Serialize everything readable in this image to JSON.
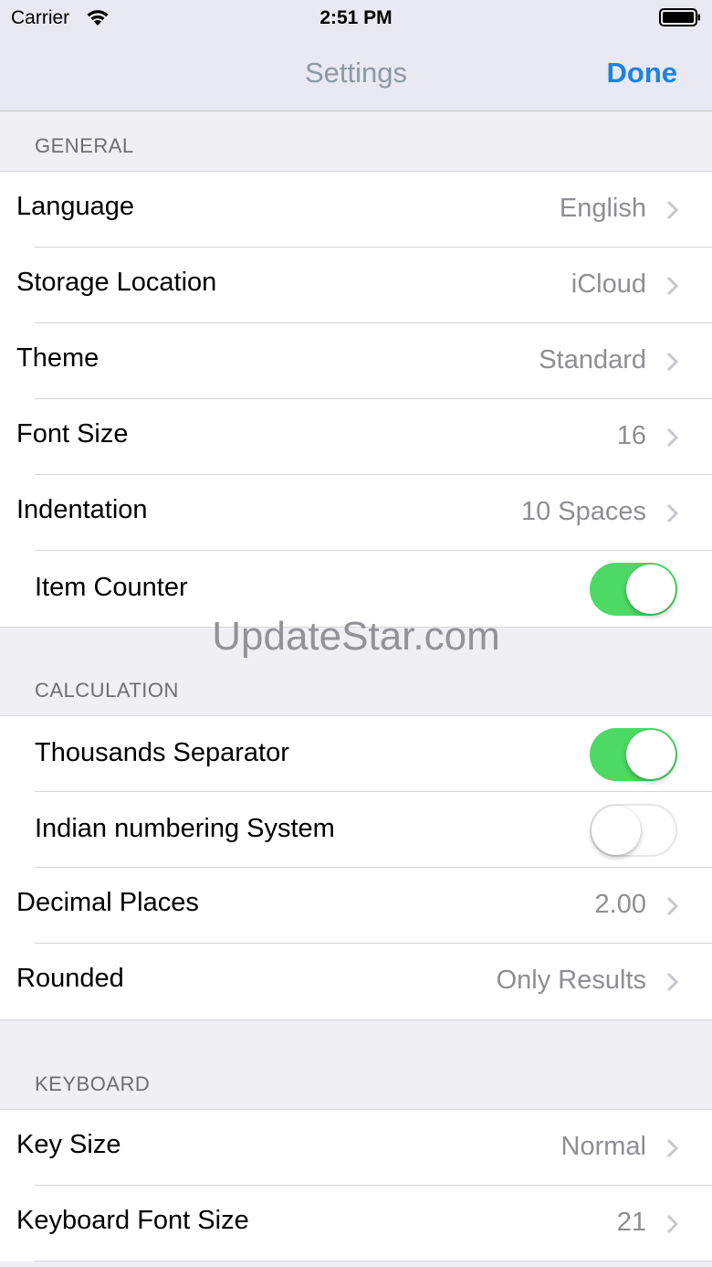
{
  "status_bar": {
    "carrier": "Carrier",
    "time": "2:51 PM"
  },
  "nav": {
    "title": "Settings",
    "done_label": "Done"
  },
  "sections": {
    "general": {
      "header": "GENERAL",
      "rows": [
        {
          "label": "Language",
          "value": "English"
        },
        {
          "label": "Storage Location",
          "value": "iCloud"
        },
        {
          "label": "Theme",
          "value": "Standard"
        },
        {
          "label": "Font Size",
          "value": "16"
        },
        {
          "label": "Indentation",
          "value": "10 Spaces"
        },
        {
          "label": "Item Counter",
          "toggle": true
        }
      ]
    },
    "calculation": {
      "header": "CALCULATION",
      "rows": [
        {
          "label": "Thousands Separator",
          "toggle": true
        },
        {
          "label": "Indian numbering System",
          "toggle": false
        },
        {
          "label": "Decimal Places",
          "value": "2.00"
        },
        {
          "label": "Rounded",
          "value": "Only Results"
        }
      ]
    },
    "keyboard": {
      "header": "KEYBOARD",
      "rows": [
        {
          "label": "Key Size",
          "value": "Normal"
        },
        {
          "label": "Keyboard Font Size",
          "value": "21"
        }
      ]
    }
  },
  "watermark": "UpdateStar.com",
  "colors": {
    "accent": "#1d82e3",
    "switch_on": "#4cd964",
    "background": "#efeff4"
  },
  "icons": {
    "chevron": "chevron-right-icon",
    "wifi": "wifi-icon",
    "battery": "battery-icon"
  }
}
